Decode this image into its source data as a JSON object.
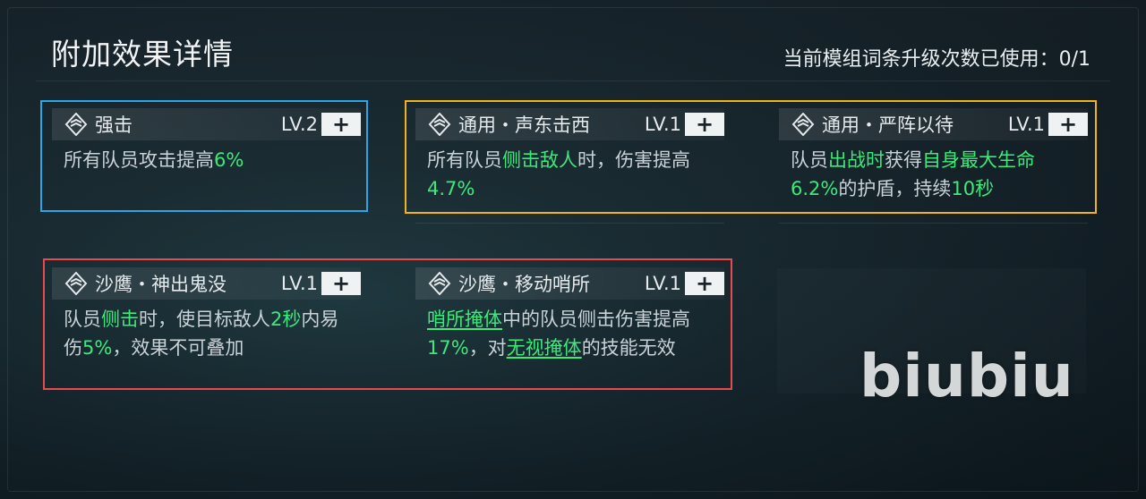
{
  "header": {
    "title": "附加效果详情",
    "usage": "当前模组词条升级次数已使用：0/1"
  },
  "cards": [
    {
      "name": "强击",
      "level": "LV.2",
      "plus": "+",
      "desc": [
        {
          "t": "所有队员攻击提高"
        },
        {
          "t": "6%",
          "s": "hl"
        }
      ]
    },
    {
      "name": "通用・声东击西",
      "level": "LV.1",
      "plus": "+",
      "desc": [
        {
          "t": "所有队员"
        },
        {
          "t": "侧击敌人",
          "s": "hl"
        },
        {
          "t": "时，伤害提高"
        },
        {
          "t": "4.7%",
          "s": "hl"
        }
      ]
    },
    {
      "name": "通用・严阵以待",
      "level": "LV.1",
      "plus": "+",
      "desc": [
        {
          "t": "队员"
        },
        {
          "t": "出战时",
          "s": "hl"
        },
        {
          "t": "获得"
        },
        {
          "t": "自身最大生命6.2%",
          "s": "hl"
        },
        {
          "t": "的护盾，持续"
        },
        {
          "t": "10秒",
          "s": "hl"
        }
      ]
    },
    {
      "name": "沙鹰・神出鬼没",
      "level": "LV.1",
      "plus": "+",
      "desc": [
        {
          "t": "队员"
        },
        {
          "t": "侧击",
          "s": "hl"
        },
        {
          "t": "时，使目标敌人"
        },
        {
          "t": "2秒",
          "s": "hl"
        },
        {
          "t": "内易伤"
        },
        {
          "t": "5%",
          "s": "hl"
        },
        {
          "t": "，效果不可叠加"
        }
      ]
    },
    {
      "name": "沙鹰・移动哨所",
      "level": "LV.1",
      "plus": "+",
      "desc": [
        {
          "t": "哨所掩体",
          "s": "ul"
        },
        {
          "t": "中的队员侧击伤害提高"
        },
        {
          "t": "17%",
          "s": "hl"
        },
        {
          "t": "，对"
        },
        {
          "t": "无视掩体",
          "s": "ul"
        },
        {
          "t": "的技能无效"
        }
      ]
    }
  ],
  "watermark": "biubiu",
  "colors": {
    "highlight": "#3cea7a",
    "group_blue": "#2aa6e8",
    "group_gold": "#f0b21d",
    "group_red": "#e84a50"
  },
  "icons": {
    "module": "module-hex-icon",
    "upgrade": "plus-icon"
  }
}
